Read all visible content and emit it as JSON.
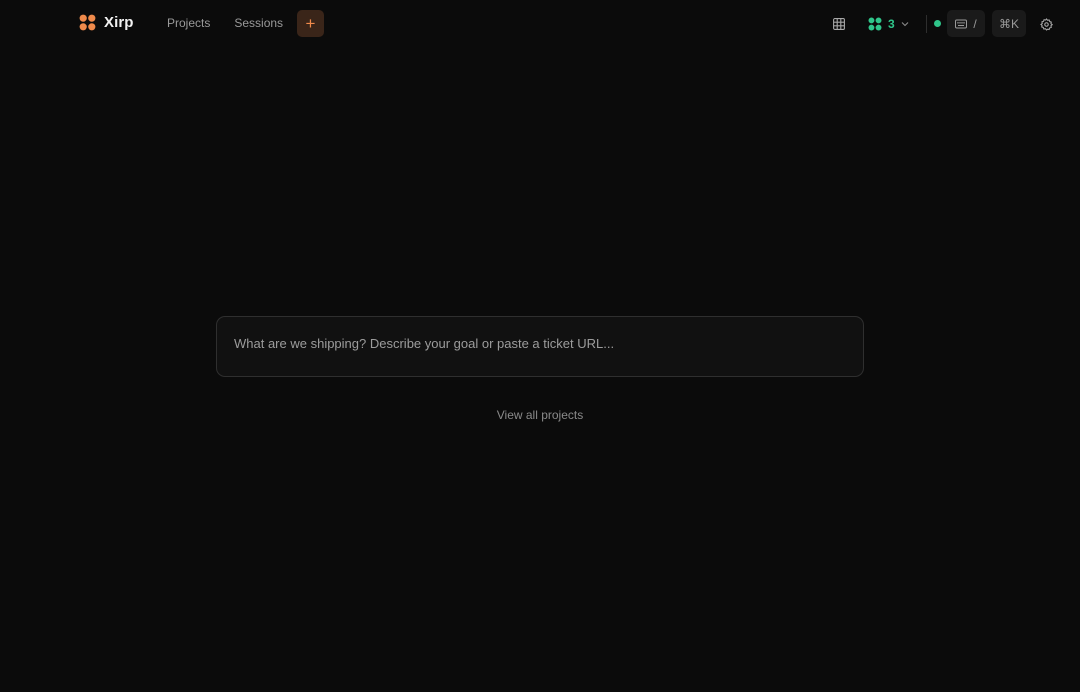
{
  "app": {
    "name": "Xirp",
    "accent": "#f08a4b",
    "status_color": "#2fc58a"
  },
  "nav": {
    "items": [
      {
        "label": "Projects"
      },
      {
        "label": "Sessions"
      }
    ],
    "new_label": "+"
  },
  "toolbar": {
    "agents_count": "3",
    "keyboard_shortcut": "/",
    "command_palette": "⌘K",
    "icons": [
      "grid-icon",
      "agents-icon",
      "chevron-down-icon",
      "keyboard-icon",
      "gear-icon"
    ]
  },
  "prompt": {
    "placeholder": "What are we shipping? Describe your goal or paste a ticket URL...",
    "value": ""
  },
  "links": {
    "view_all": "View all projects"
  }
}
